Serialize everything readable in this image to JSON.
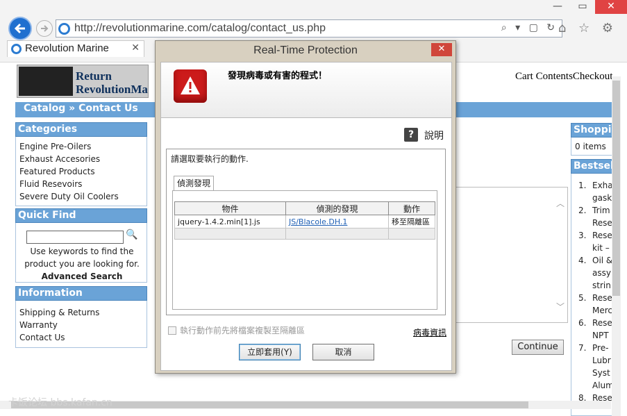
{
  "browser": {
    "url": "http://revolutionmarine.com/catalog/contact_us.php",
    "tab_title": "Revolution Marine",
    "tab_close": "✕",
    "addr_tools": "⌕ ▾ ▢ ↻",
    "nav_icons": "⌂ ☆ ⚙",
    "minimize": "—",
    "maximize": "▭",
    "close": "✕"
  },
  "site": {
    "logo_text_line1": "Return",
    "logo_text_line2": "RevolutionMa",
    "cart_links": "Cart ContentsCheckout",
    "breadcrumb": "Catalog » Contact Us",
    "categories_title": "Categories",
    "categories": [
      "Engine Pre-Oilers",
      "Exhaust Accesories",
      "Featured Products",
      "Fluid Resevoirs",
      "Severe Duty Oil Coolers"
    ],
    "quick_find_title": "Quick Find",
    "quick_find_text": "Use keywords to find the product you are looking for.",
    "advanced_search": "Advanced Search",
    "information_title": "Information",
    "information_items": [
      "Shipping & Returns",
      "Warranty",
      "Contact Us"
    ],
    "shopping_title": "Shopping Cart",
    "shopping_items": "0 items",
    "bestsellers_title": "Bestsellers",
    "bestsellers_lines": [
      "1.",
      "Exha",
      "gask",
      "2.",
      "Trim",
      "Rese",
      "3.",
      "Rese",
      "kit –",
      "4.",
      "Oil &",
      "assy",
      "strin",
      "5.",
      "Rese",
      "Merc",
      "6.",
      "Rese",
      "NPT",
      "7.",
      "Pre-",
      "Lubr",
      "Syst",
      "Alum",
      "8.",
      "Rese"
    ],
    "continue_label": "Continue",
    "watermark": "卡饭论坛 bbs.kafan.cn"
  },
  "dialog": {
    "title": "Real-Time Protection",
    "close": "✕",
    "warning": "發現病毒或有害的程式！",
    "help_icon": "?",
    "help_label": "說明",
    "group_label": "請選取要執行的動作.",
    "subtab": "偵測發現",
    "columns": [
      "物件",
      "偵測的發現",
      "動作"
    ],
    "rows": [
      {
        "object": "jquery-1.4.2.min[1].js",
        "detection": "JS/Blacole.DH.1",
        "action": "移至隔離區"
      }
    ],
    "checkbox_label": "執行動作前先將檔案複製至隔離區",
    "virus_info": "病毒資訊",
    "apply_button": "立即套用(Y)",
    "cancel_button": "取消"
  }
}
